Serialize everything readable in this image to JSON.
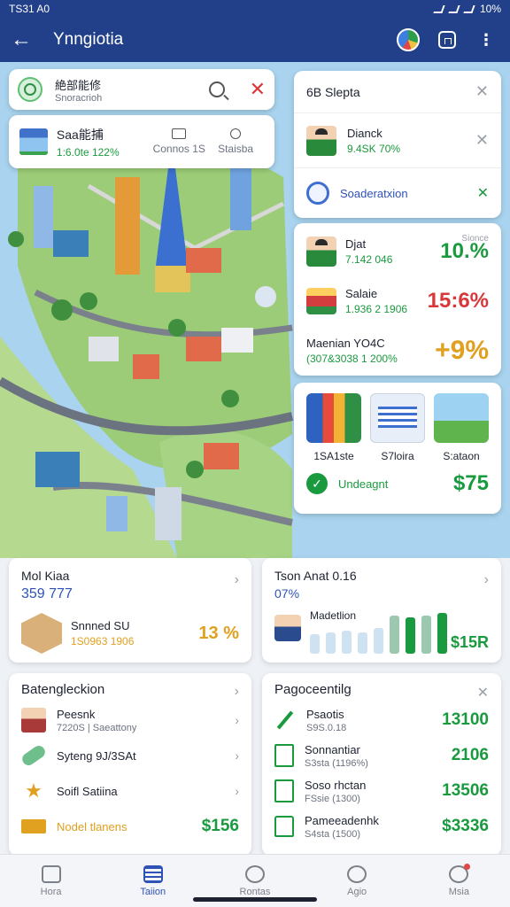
{
  "status": {
    "time": "TS31 A0",
    "battery": "10%"
  },
  "appbar": {
    "back": "←",
    "title": "Ynngiotia",
    "more": "⋮"
  },
  "search": {
    "title": "絶部能修",
    "subtitle": "Snoracrioh"
  },
  "location": {
    "name": "Saa能捕",
    "value": "1:6.0te 122%",
    "col1": "Connos 1S",
    "col2": "Staisba"
  },
  "right1": {
    "title": "6B Slepta",
    "person": {
      "name": "Dianck",
      "detail": "9.4SK 70%"
    },
    "item": {
      "label": "Soaderatxion"
    }
  },
  "right2": {
    "rows": [
      {
        "name": "Djat",
        "detail": "7.142 046",
        "pct": "10.%",
        "tag": "Sionce"
      },
      {
        "name": "Salaie",
        "detail": "1.936 2 1906",
        "pct": "15:6%"
      },
      {
        "name": "Maenian YO4C",
        "detail": "(307&3038 1 200%",
        "pct": "+9%"
      }
    ]
  },
  "right3": {
    "items": [
      "1SA1ste",
      "S7loira",
      "S:ataon"
    ],
    "footer": {
      "label": "Undeagnt",
      "amount": "$75"
    }
  },
  "card1": {
    "title": "Mol Kiaa",
    "value": "359 777",
    "item": "Snnned SU",
    "detail": "1S0963 1906",
    "pct": "13 %"
  },
  "card2": {
    "title": "Tson Anat 0.16",
    "sub": "07%",
    "label": "Madetlion",
    "amount": "$15R",
    "bars": [
      0.45,
      0.5,
      0.55,
      0.5,
      0.6,
      0.9,
      0.85,
      0.9,
      0.95
    ]
  },
  "card3": {
    "title": "Batengleckion",
    "rows": [
      {
        "name": "Peesnk",
        "detail": "7220S | Saeattony"
      },
      {
        "name": "Syteng 9J/3SAt",
        "detail": ""
      },
      {
        "name": "Soifl Satiina",
        "detail": ""
      }
    ],
    "footer": {
      "label": "Nodel tlanens",
      "amount": "$156"
    }
  },
  "card4": {
    "title": "Pagoceentilg",
    "rows": [
      {
        "name": "Psaotis",
        "detail": "S9S.0.18",
        "amount": "13100"
      },
      {
        "name": "Sonnantiar",
        "detail": "S3sta (1196%)",
        "amount": "2106"
      },
      {
        "name": "Soso rhctan",
        "detail": "FSsie (1300)",
        "amount": "13506"
      },
      {
        "name": "Pameeadenhk",
        "detail": "S4sta (1500)",
        "amount": "$3336"
      }
    ]
  },
  "nav": [
    "Hora",
    "Taiion",
    "Rontas",
    "Agio",
    "Msia"
  ],
  "colors": {
    "appbar": "#22408a",
    "accent": "#1a9a3f",
    "red": "#d8383a",
    "orange": "#e0a020"
  }
}
